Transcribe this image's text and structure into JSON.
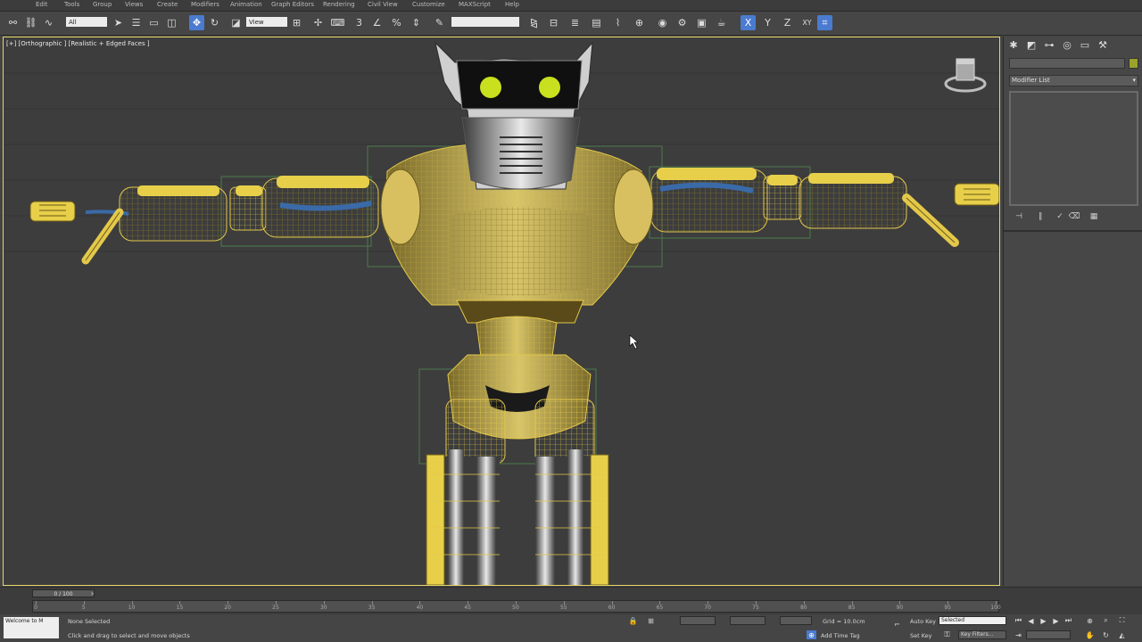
{
  "menubar": {
    "items": [
      "Edit",
      "Tools",
      "Group",
      "Views",
      "Create",
      "Modifiers",
      "Animation",
      "Graph Editors",
      "Rendering",
      "Civil View",
      "Customize",
      "MAXScript",
      "Help"
    ]
  },
  "toolbar": {
    "selection_filter": "All",
    "ref_coord": "View",
    "named_selection": "",
    "axis_x": "X",
    "axis_y": "Y",
    "axis_z": "Z",
    "axis_xy": "XY"
  },
  "viewport": {
    "label": "[+] [Orthographic ] [Realistic + Edged Faces ]"
  },
  "command_panel": {
    "modifier_list": "Modifier List"
  },
  "timeline": {
    "slider_label": "0 / 100",
    "ticks": [
      "0",
      "5",
      "10",
      "15",
      "20",
      "25",
      "30",
      "35",
      "40",
      "45",
      "50",
      "55",
      "60",
      "65",
      "70",
      "75",
      "80",
      "85",
      "90",
      "95",
      "100"
    ]
  },
  "status": {
    "listener_text": "Welcome to M",
    "selection_text": "None Selected",
    "prompt_text": "Click and drag to select and move objects",
    "grid_text": "Grid = 10.0cm",
    "auto_key": "Auto Key",
    "selected_value": "Selected",
    "set_key": "Set Key",
    "key_filters": "Key Filters...",
    "add_time_tag": "Add Time Tag"
  },
  "colors": {
    "active_tool": "#4a7bd0",
    "viewport_border": "#e6d56a",
    "wire_yellow": "#e3c84a",
    "eye_glow": "#c9e01e"
  },
  "icons": [
    "select-link-icon",
    "select-object-icon",
    "move-icon",
    "rotate-icon",
    "scale-icon",
    "snap-icon",
    "mirror-icon",
    "align-icon",
    "render-icon",
    "viewcube-icon",
    "play-icon"
  ]
}
